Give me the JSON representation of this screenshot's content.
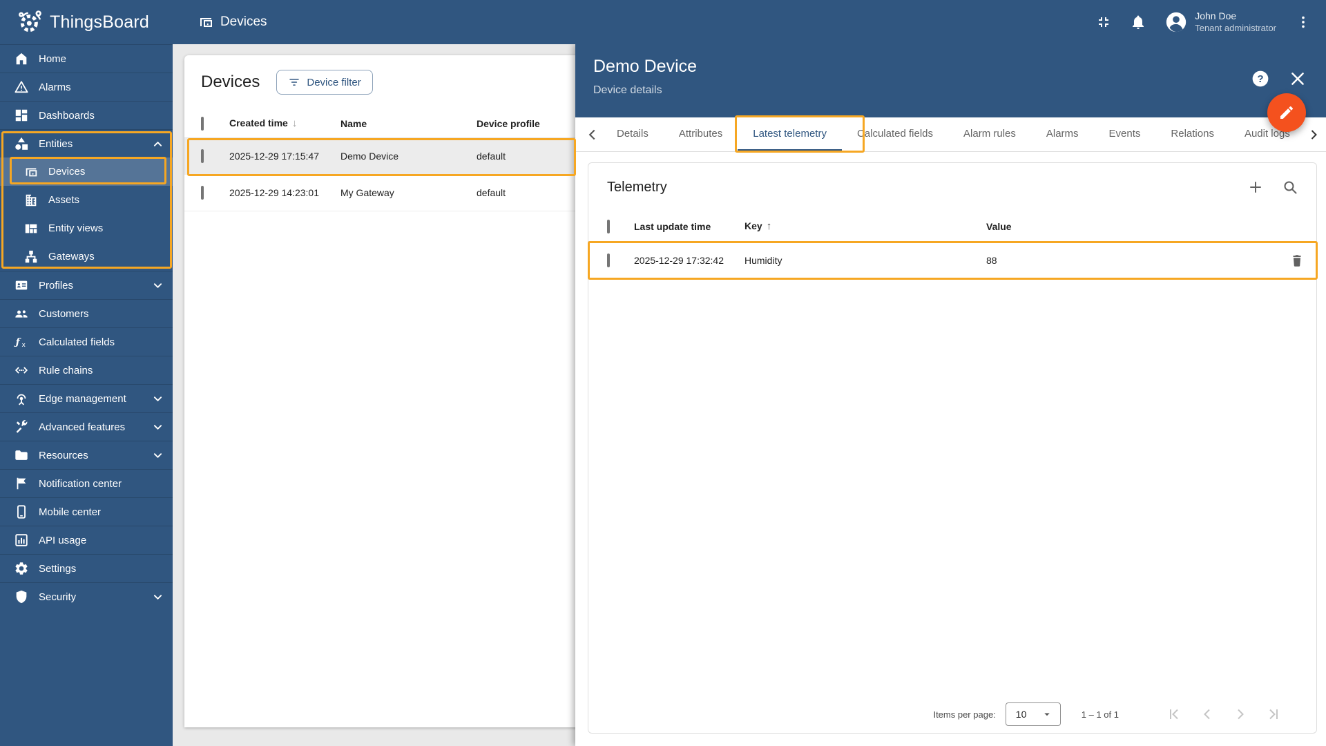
{
  "colors": {
    "primary": "#305680",
    "annotation": "#f6a723",
    "fab": "#f4511e",
    "selected_row": "#ececec"
  },
  "app_bar": {
    "logo_text": "ThingsBoard",
    "breadcrumb": "Devices",
    "user": {
      "name": "John Doe",
      "role": "Tenant administrator"
    }
  },
  "sidebar": {
    "items": [
      {
        "label": "Home"
      },
      {
        "label": "Alarms"
      },
      {
        "label": "Dashboards"
      },
      {
        "label": "Entities"
      },
      {
        "label": "Devices"
      },
      {
        "label": "Assets"
      },
      {
        "label": "Entity views"
      },
      {
        "label": "Gateways"
      },
      {
        "label": "Profiles"
      },
      {
        "label": "Customers"
      },
      {
        "label": "Calculated fields"
      },
      {
        "label": "Rule chains"
      },
      {
        "label": "Edge management"
      },
      {
        "label": "Advanced features"
      },
      {
        "label": "Resources"
      },
      {
        "label": "Notification center"
      },
      {
        "label": "Mobile center"
      },
      {
        "label": "API usage"
      },
      {
        "label": "Settings"
      },
      {
        "label": "Security"
      }
    ]
  },
  "devices_table": {
    "title": "Devices",
    "filter_button": "Device filter",
    "columns": {
      "created_time": "Created time",
      "name": "Name",
      "device_profile": "Device profile"
    },
    "rows": [
      {
        "created_time": "2025-12-29 17:15:47",
        "name": "Demo Device",
        "device_profile": "default"
      },
      {
        "created_time": "2025-12-29 14:23:01",
        "name": "My Gateway",
        "device_profile": "default"
      }
    ]
  },
  "details_panel": {
    "title": "Demo Device",
    "subtitle": "Device details",
    "tabs": [
      "Details",
      "Attributes",
      "Latest telemetry",
      "Calculated fields",
      "Alarm rules",
      "Alarms",
      "Events",
      "Relations",
      "Audit logs"
    ],
    "active_tab": "Latest telemetry"
  },
  "telemetry": {
    "title": "Telemetry",
    "columns": {
      "last_update_time": "Last update time",
      "key": "Key",
      "value": "Value"
    },
    "rows": [
      {
        "last_update_time": "2025-12-29 17:32:42",
        "key": "Humidity",
        "value": "88"
      }
    ],
    "pagination": {
      "items_per_page_label": "Items per page:",
      "items_per_page": "10",
      "range": "1 – 1 of 1"
    }
  },
  "icons": {
    "sort_asc": "↑",
    "sort_desc": "↓"
  }
}
